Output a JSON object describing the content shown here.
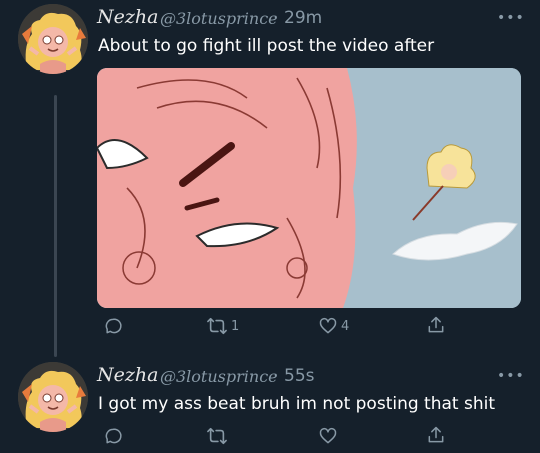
{
  "tweets": [
    {
      "display_name": "Nezha",
      "handle": "@3lotusprince",
      "separator": "·",
      "time": "29m",
      "text": "About to go fight ill post the video after",
      "more": "•••",
      "reply_count": "",
      "retweet_count": "1",
      "like_count": "4"
    },
    {
      "display_name": "Nezha",
      "handle": "@3lotusprince",
      "separator": "·",
      "time": "55s",
      "text": "I got my ass beat bruh im not posting that shit",
      "more": "•••",
      "reply_count": "",
      "retweet_count": "",
      "like_count": ""
    }
  ],
  "colors": {
    "background": "#15202b",
    "secondary_text": "#8899a6",
    "media_pink": "#f0a3a0",
    "media_blue": "#a7bfcc"
  },
  "icons": [
    "reply-icon",
    "retweet-icon",
    "like-icon",
    "share-icon",
    "more-icon"
  ]
}
